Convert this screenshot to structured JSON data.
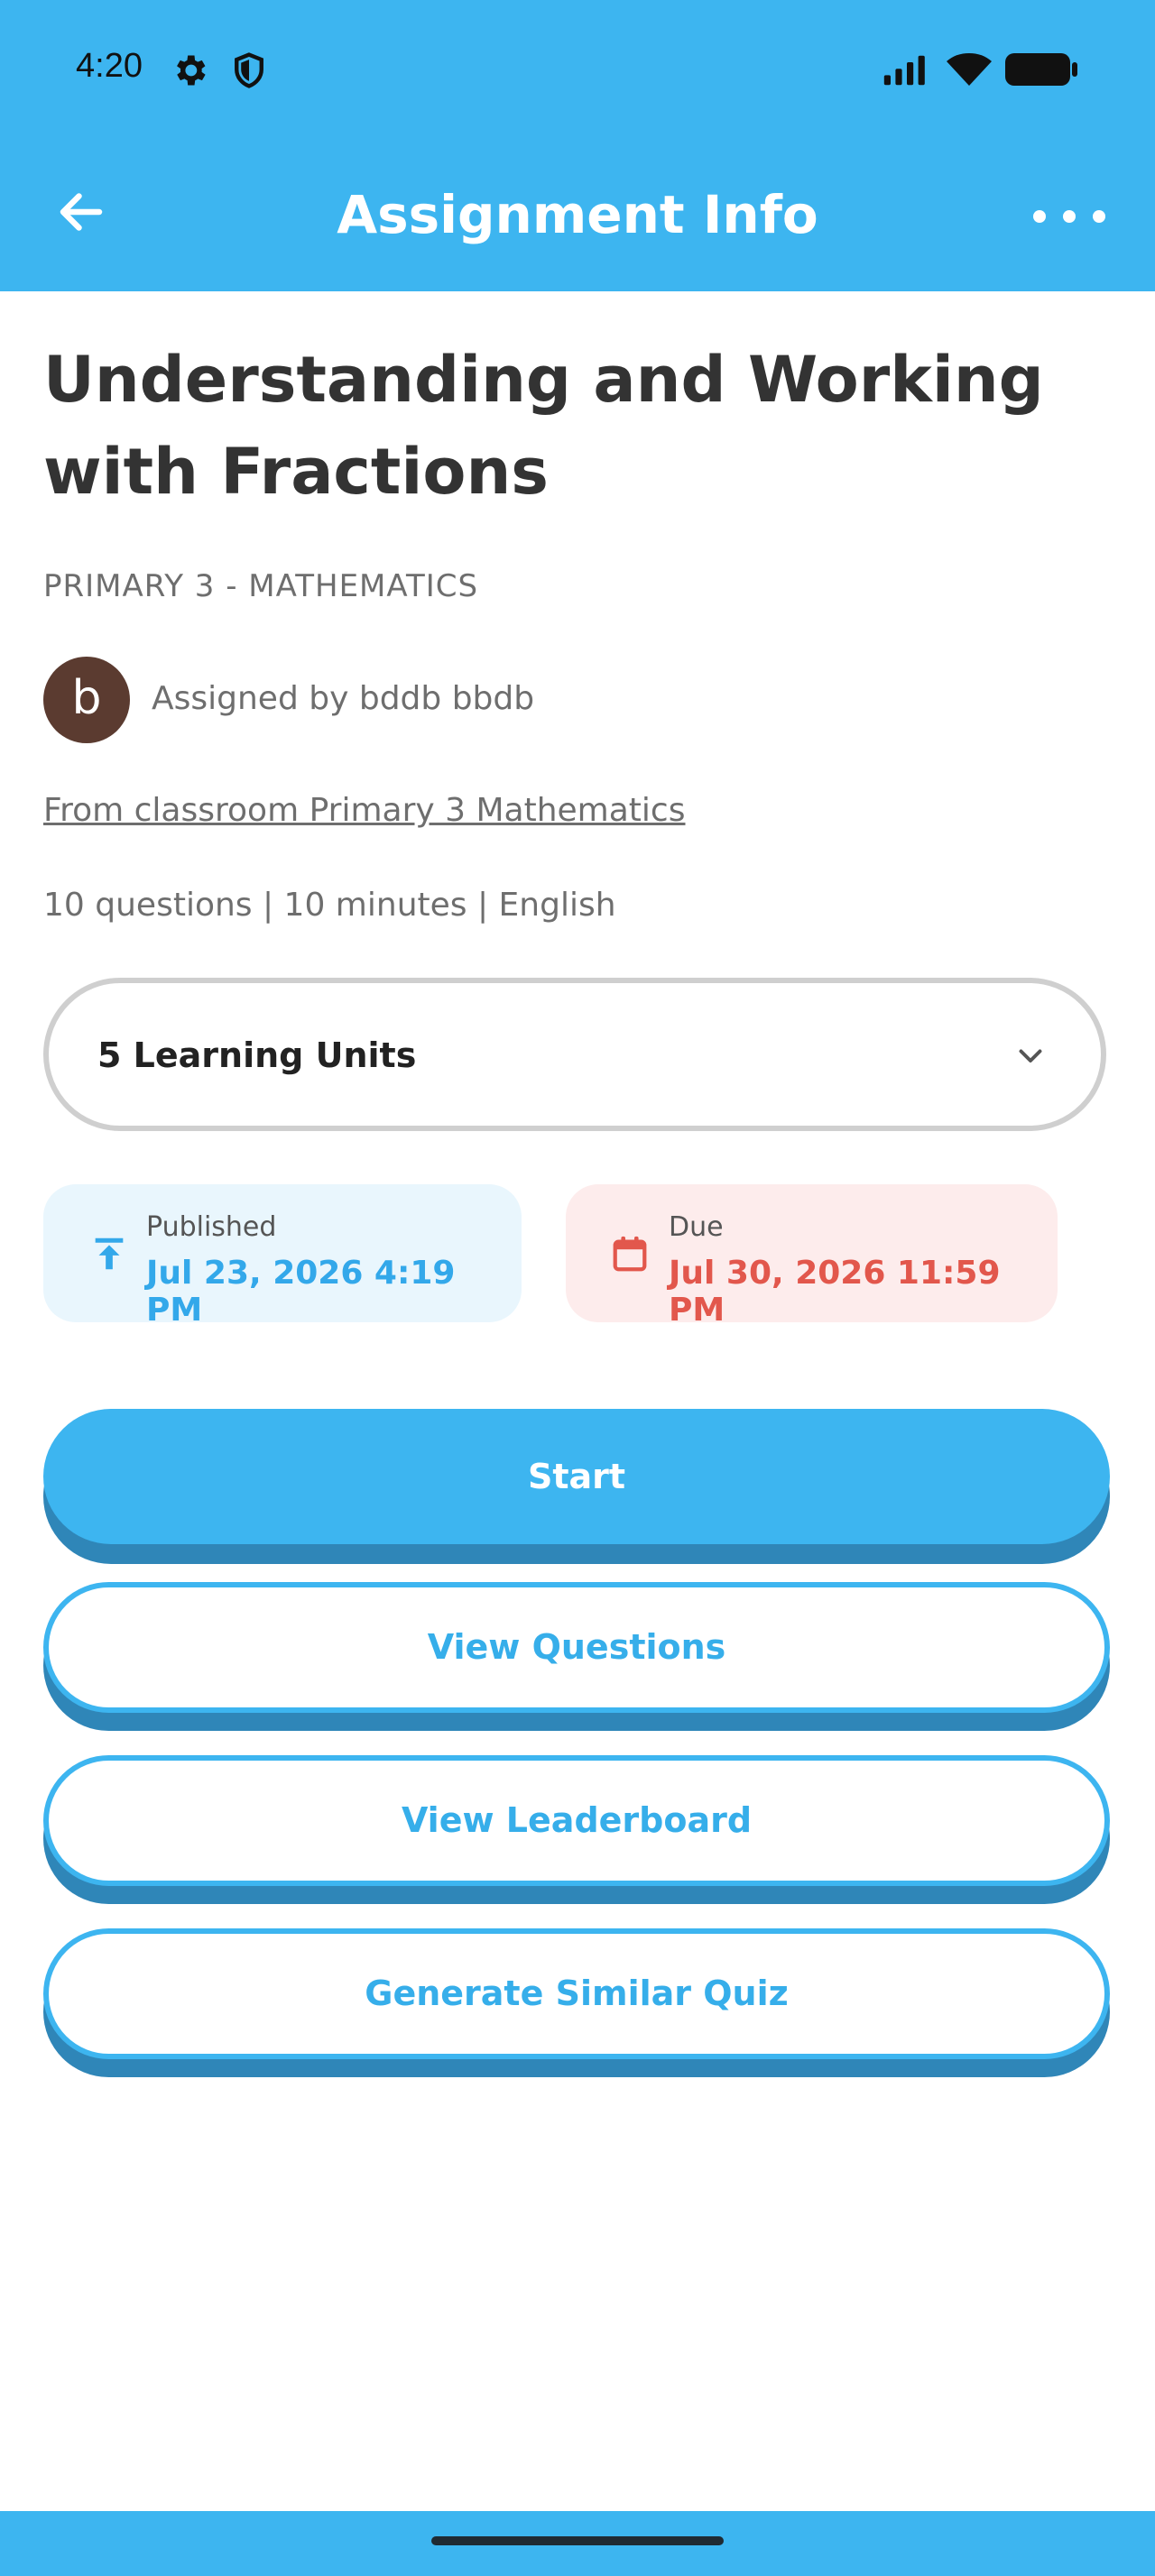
{
  "status_bar": {
    "time": "4:20"
  },
  "header": {
    "title": "Assignment Info"
  },
  "assignment": {
    "title": "Understanding and Working with Fractions",
    "class_label": "PRIMARY 3 - MATHEMATICS",
    "avatar_letter": "b",
    "assigned_by": "Assigned by bddb bbdb",
    "classroom_link": "From classroom Primary 3 Mathematics",
    "meta": "10 questions | 10 minutes | English"
  },
  "units_dropdown": {
    "label": "5 Learning Units"
  },
  "published": {
    "caption": "Published",
    "value": "Jul 23, 2026 4:19 PM"
  },
  "due": {
    "caption": "Due",
    "value": "Jul 30, 2026 11:59 PM"
  },
  "actions": {
    "start": "Start",
    "view_questions": "View Questions",
    "view_leaderboard": "View Leaderboard",
    "generate_similar": "Generate Similar Quiz"
  },
  "colors": {
    "primary": "#3db5f0",
    "primary_dark": "#2f86b8",
    "due_red": "#e2574c",
    "published_bg": "#e9f6fd",
    "due_bg": "#fdecec"
  }
}
